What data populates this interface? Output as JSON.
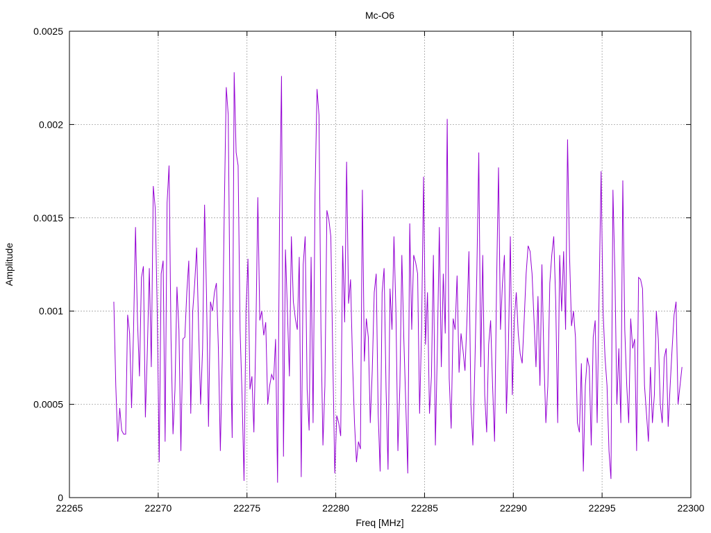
{
  "chart_data": {
    "type": "line",
    "title": "Mc-O6",
    "xlabel": "Freq [MHz]",
    "ylabel": "Amplitude",
    "xlim": [
      22265,
      22300
    ],
    "ylim": [
      0,
      0.0025
    ],
    "x_ticks": [
      "22265",
      "22270",
      "22275",
      "22280",
      "22285",
      "22290",
      "22295",
      "22300"
    ],
    "y_ticks": [
      "0",
      "0.0005",
      "0.001",
      "0.0015",
      "0.002",
      "0.0025"
    ],
    "grid": true,
    "legend": "none",
    "series": [
      {
        "color": "#9400d3",
        "x_start": 22267.5,
        "x_end": 22299.5,
        "y": [
          0.00105,
          0.0006,
          0.0003,
          0.00048,
          0.00036,
          0.00034,
          0.00034,
          0.00098,
          0.00088,
          0.00048,
          0.0009,
          0.00145,
          0.00095,
          0.00065,
          0.00118,
          0.00124,
          0.00043,
          0.00079,
          0.00123,
          0.0007,
          0.00167,
          0.00155,
          0.001,
          0.00019,
          0.0012,
          0.00127,
          0.0003,
          0.00158,
          0.00178,
          0.00085,
          0.00034,
          0.00058,
          0.00113,
          0.0009,
          0.00025,
          0.00085,
          0.00086,
          0.0011,
          0.00127,
          0.00045,
          0.001,
          0.00115,
          0.00134,
          0.0009,
          0.0005,
          0.0008,
          0.00157,
          0.00108,
          0.00038,
          0.00105,
          0.001,
          0.0011,
          0.00115,
          0.0008,
          0.00025,
          0.00076,
          0.00155,
          0.0022,
          0.00205,
          0.0009,
          0.00032,
          0.00228,
          0.00185,
          0.00178,
          0.0009,
          0.00055,
          9e-05,
          0.001,
          0.00128,
          0.00058,
          0.00065,
          0.00035,
          0.00088,
          0.00161,
          0.00095,
          0.001,
          0.00087,
          0.00094,
          0.0005,
          0.0006,
          0.00066,
          0.00063,
          0.00085,
          8e-05,
          0.0015,
          0.00226,
          0.00022,
          0.00133,
          0.001,
          0.00065,
          0.0014,
          0.00105,
          0.00096,
          0.0009,
          0.00129,
          0.00011,
          0.00125,
          0.0014,
          0.00058,
          0.00036,
          0.00129,
          0.0004,
          0.00163,
          0.00219,
          0.00205,
          0.0009,
          0.00028,
          0.0006,
          0.00154,
          0.00149,
          0.0014,
          0.00075,
          0.00013,
          0.00044,
          0.0004,
          0.00033,
          0.00135,
          0.00094,
          0.0018,
          0.00104,
          0.00117,
          0.00073,
          0.0004,
          0.00019,
          0.0003,
          0.00026,
          0.00165,
          0.00073,
          0.00096,
          0.00086,
          0.0004,
          0.00068,
          0.0011,
          0.0012,
          0.00045,
          0.00014,
          0.0011,
          0.00123,
          0.00058,
          0.00015,
          0.00112,
          0.0009,
          0.0014,
          0.001,
          0.00025,
          0.0006,
          0.0013,
          0.00085,
          0.0005,
          0.00013,
          0.00147,
          0.0009,
          0.0013,
          0.00126,
          0.0012,
          0.00045,
          0.0009,
          0.00172,
          0.00082,
          0.0011,
          0.00045,
          0.00065,
          0.0013,
          0.00028,
          0.0008,
          0.00145,
          0.0007,
          0.0012,
          0.00088,
          0.00203,
          0.00064,
          0.00037,
          0.00096,
          0.0009,
          0.00119,
          0.00067,
          0.00088,
          0.00079,
          0.00068,
          0.00095,
          0.00132,
          0.0005,
          0.00028,
          0.0007,
          0.0012,
          0.00185,
          0.0007,
          0.0013,
          0.00055,
          0.00035,
          0.00082,
          0.00095,
          0.0006,
          0.0003,
          0.00113,
          0.00177,
          0.0009,
          0.00115,
          0.0013,
          0.00045,
          0.0008,
          0.0014,
          0.00055,
          0.00095,
          0.0011,
          0.00088,
          0.00077,
          0.00072,
          0.00095,
          0.0012,
          0.00135,
          0.00132,
          0.0012,
          0.00095,
          0.0007,
          0.00108,
          0.0006,
          0.00125,
          0.00075,
          0.0004,
          0.0006,
          0.00115,
          0.0013,
          0.0014,
          0.00105,
          0.0004,
          0.0013,
          0.001,
          0.00132,
          0.0009,
          0.00192,
          0.0013,
          0.00092,
          0.001,
          0.00086,
          0.0004,
          0.00035,
          0.00072,
          0.00014,
          0.0006,
          0.00075,
          0.0007,
          0.00028,
          0.00086,
          0.00095,
          0.0004,
          0.0011,
          0.00175,
          0.001,
          0.00075,
          0.0006,
          0.00025,
          0.0001,
          0.00165,
          0.0012,
          0.0005,
          0.0008,
          0.0004,
          0.0017,
          0.0009,
          0.0006,
          0.0004,
          0.00096,
          0.0008,
          0.00085,
          0.00025,
          0.00118,
          0.00117,
          0.00112,
          0.0006,
          0.00045,
          0.0003,
          0.0007,
          0.0004,
          0.00055,
          0.001,
          0.00085,
          0.0005,
          0.0004,
          0.00075,
          0.0008,
          0.00038,
          0.0006,
          0.0008,
          0.00098,
          0.00105,
          0.0005,
          0.0006,
          0.0007
        ]
      }
    ]
  }
}
